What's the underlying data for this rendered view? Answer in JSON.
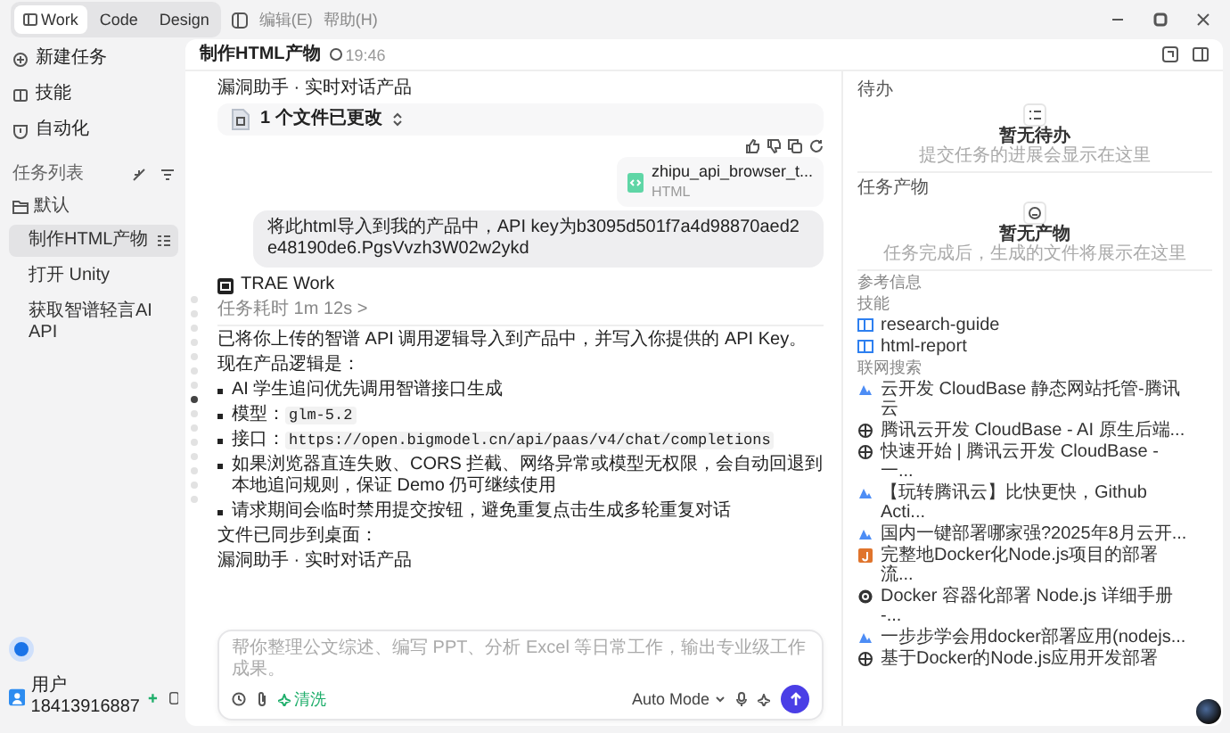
{
  "window": {
    "tabs": [
      {
        "label": "Work",
        "selected": true
      },
      {
        "label": "Code",
        "selected": false
      },
      {
        "label": "Design",
        "selected": false
      }
    ],
    "menu": [
      "编辑(E)",
      "帮助(H)"
    ]
  },
  "sidebar": {
    "actions": [
      {
        "label": "新建任务",
        "kind": "new"
      },
      {
        "label": "技能",
        "kind": "skills"
      },
      {
        "label": "自动化",
        "kind": "automation"
      }
    ],
    "list_title": "任务列表",
    "groups": [
      {
        "label": "默认",
        "expanded": true,
        "children": [
          {
            "label": "制作HTML产物",
            "selected": true
          },
          {
            "label": "打开 Unity",
            "selected": false
          },
          {
            "label": "获取智谱轻言AI API",
            "selected": false
          }
        ]
      }
    ],
    "user": "用户18413916887"
  },
  "task": {
    "title": "制作HTML产物",
    "time": "19:46"
  },
  "timeline": [
    {
      "selected": false
    },
    {
      "selected": false
    },
    {
      "selected": false
    },
    {
      "selected": false
    },
    {
      "selected": false
    },
    {
      "selected": false
    },
    {
      "selected": false
    },
    {
      "selected": true
    },
    {
      "selected": false
    },
    {
      "selected": false
    },
    {
      "selected": false
    },
    {
      "selected": false
    },
    {
      "selected": false
    },
    {
      "selected": false
    },
    {
      "selected": false
    }
  ],
  "conversation": {
    "previous_tail": "漏洞助手 · 实时对话产品",
    "changed_files": "1 个文件已更改",
    "attachment": {
      "name": "zhipu_api_browser_t...",
      "type": "HTML"
    },
    "user_message": "将此html导入到我的产品中，API key为b3095d501f7a4d98870aed2e48190de6.PgsVvzh3W02w2ykd",
    "assistant": {
      "name": "TRAE Work",
      "duration": "任务耗时 1m 12s >",
      "blocks": [
        {
          "kind": "p",
          "text": "已将你上传的智谱 API 调用逻辑导入到产品中，并写入你提供的 API Key。"
        },
        {
          "kind": "p",
          "text": "现在产品逻辑是："
        },
        {
          "kind": "li",
          "text": "AI 学生追问优先调用智谱接口生成"
        },
        {
          "kind": "li",
          "text": "模型：",
          "code": "glm-5.2"
        },
        {
          "kind": "li",
          "text": "接口：",
          "code": "https://open.bigmodel.cn/api/paas/v4/chat/completions"
        },
        {
          "kind": "li",
          "text": "如果浏览器直连失败、CORS 拦截、网络异常或模型无权限，会自动回退到本地追问规则，保证 Demo 仍可继续使用"
        },
        {
          "kind": "li",
          "text": "请求期间会临时禁用提交按钮，避免重复点击生成多轮重复对话"
        },
        {
          "kind": "p",
          "text": "文件已同步到桌面："
        },
        {
          "kind": "p",
          "text": "漏洞助手 · 实时对话产品"
        }
      ]
    }
  },
  "composer": {
    "placeholder": "帮你整理公文综述、编写 PPT、分析 Excel 等日常工作，输出专业级工作成果。",
    "tag": "清洗",
    "mode": "Auto Mode"
  },
  "right_panel": {
    "todo": {
      "title": "待办",
      "empty_title": "暂无待办",
      "empty_text": "提交任务的进展会显示在这里"
    },
    "outputs": {
      "title": "任务产物",
      "empty_title": "暂无产物",
      "empty_text": "任务完成后，生成的文件将展示在这里"
    },
    "references": {
      "title": "参考信息",
      "skills_title": "技能",
      "skills": [
        "research-guide",
        "html-report"
      ],
      "search_title": "联网搜索",
      "results": [
        {
          "title": "云开发 CloudBase 静态网站托管-腾讯云",
          "kind": "cloud"
        },
        {
          "title": "腾讯云开发 CloudBase - AI 原生后端...",
          "kind": "globe"
        },
        {
          "title": "快速开始 | 腾讯云开发 CloudBase - 一...",
          "kind": "globe"
        },
        {
          "title": "【玩转腾讯云】比快更快，Github Acti...",
          "kind": "cloud"
        },
        {
          "title": "国内一键部署哪家强?2025年8月云开...",
          "kind": "cloud"
        },
        {
          "title": "完整地Docker化Node.js项目的部署流...",
          "kind": "orange"
        },
        {
          "title": "Docker 容器化部署 Node.js 详细手册 -...",
          "kind": "dark"
        },
        {
          "title": "一步步学会用docker部署应用(nodejs...",
          "kind": "cloud"
        },
        {
          "title": "基于Docker的Node.js应用开发部署",
          "kind": "globe"
        }
      ]
    }
  }
}
